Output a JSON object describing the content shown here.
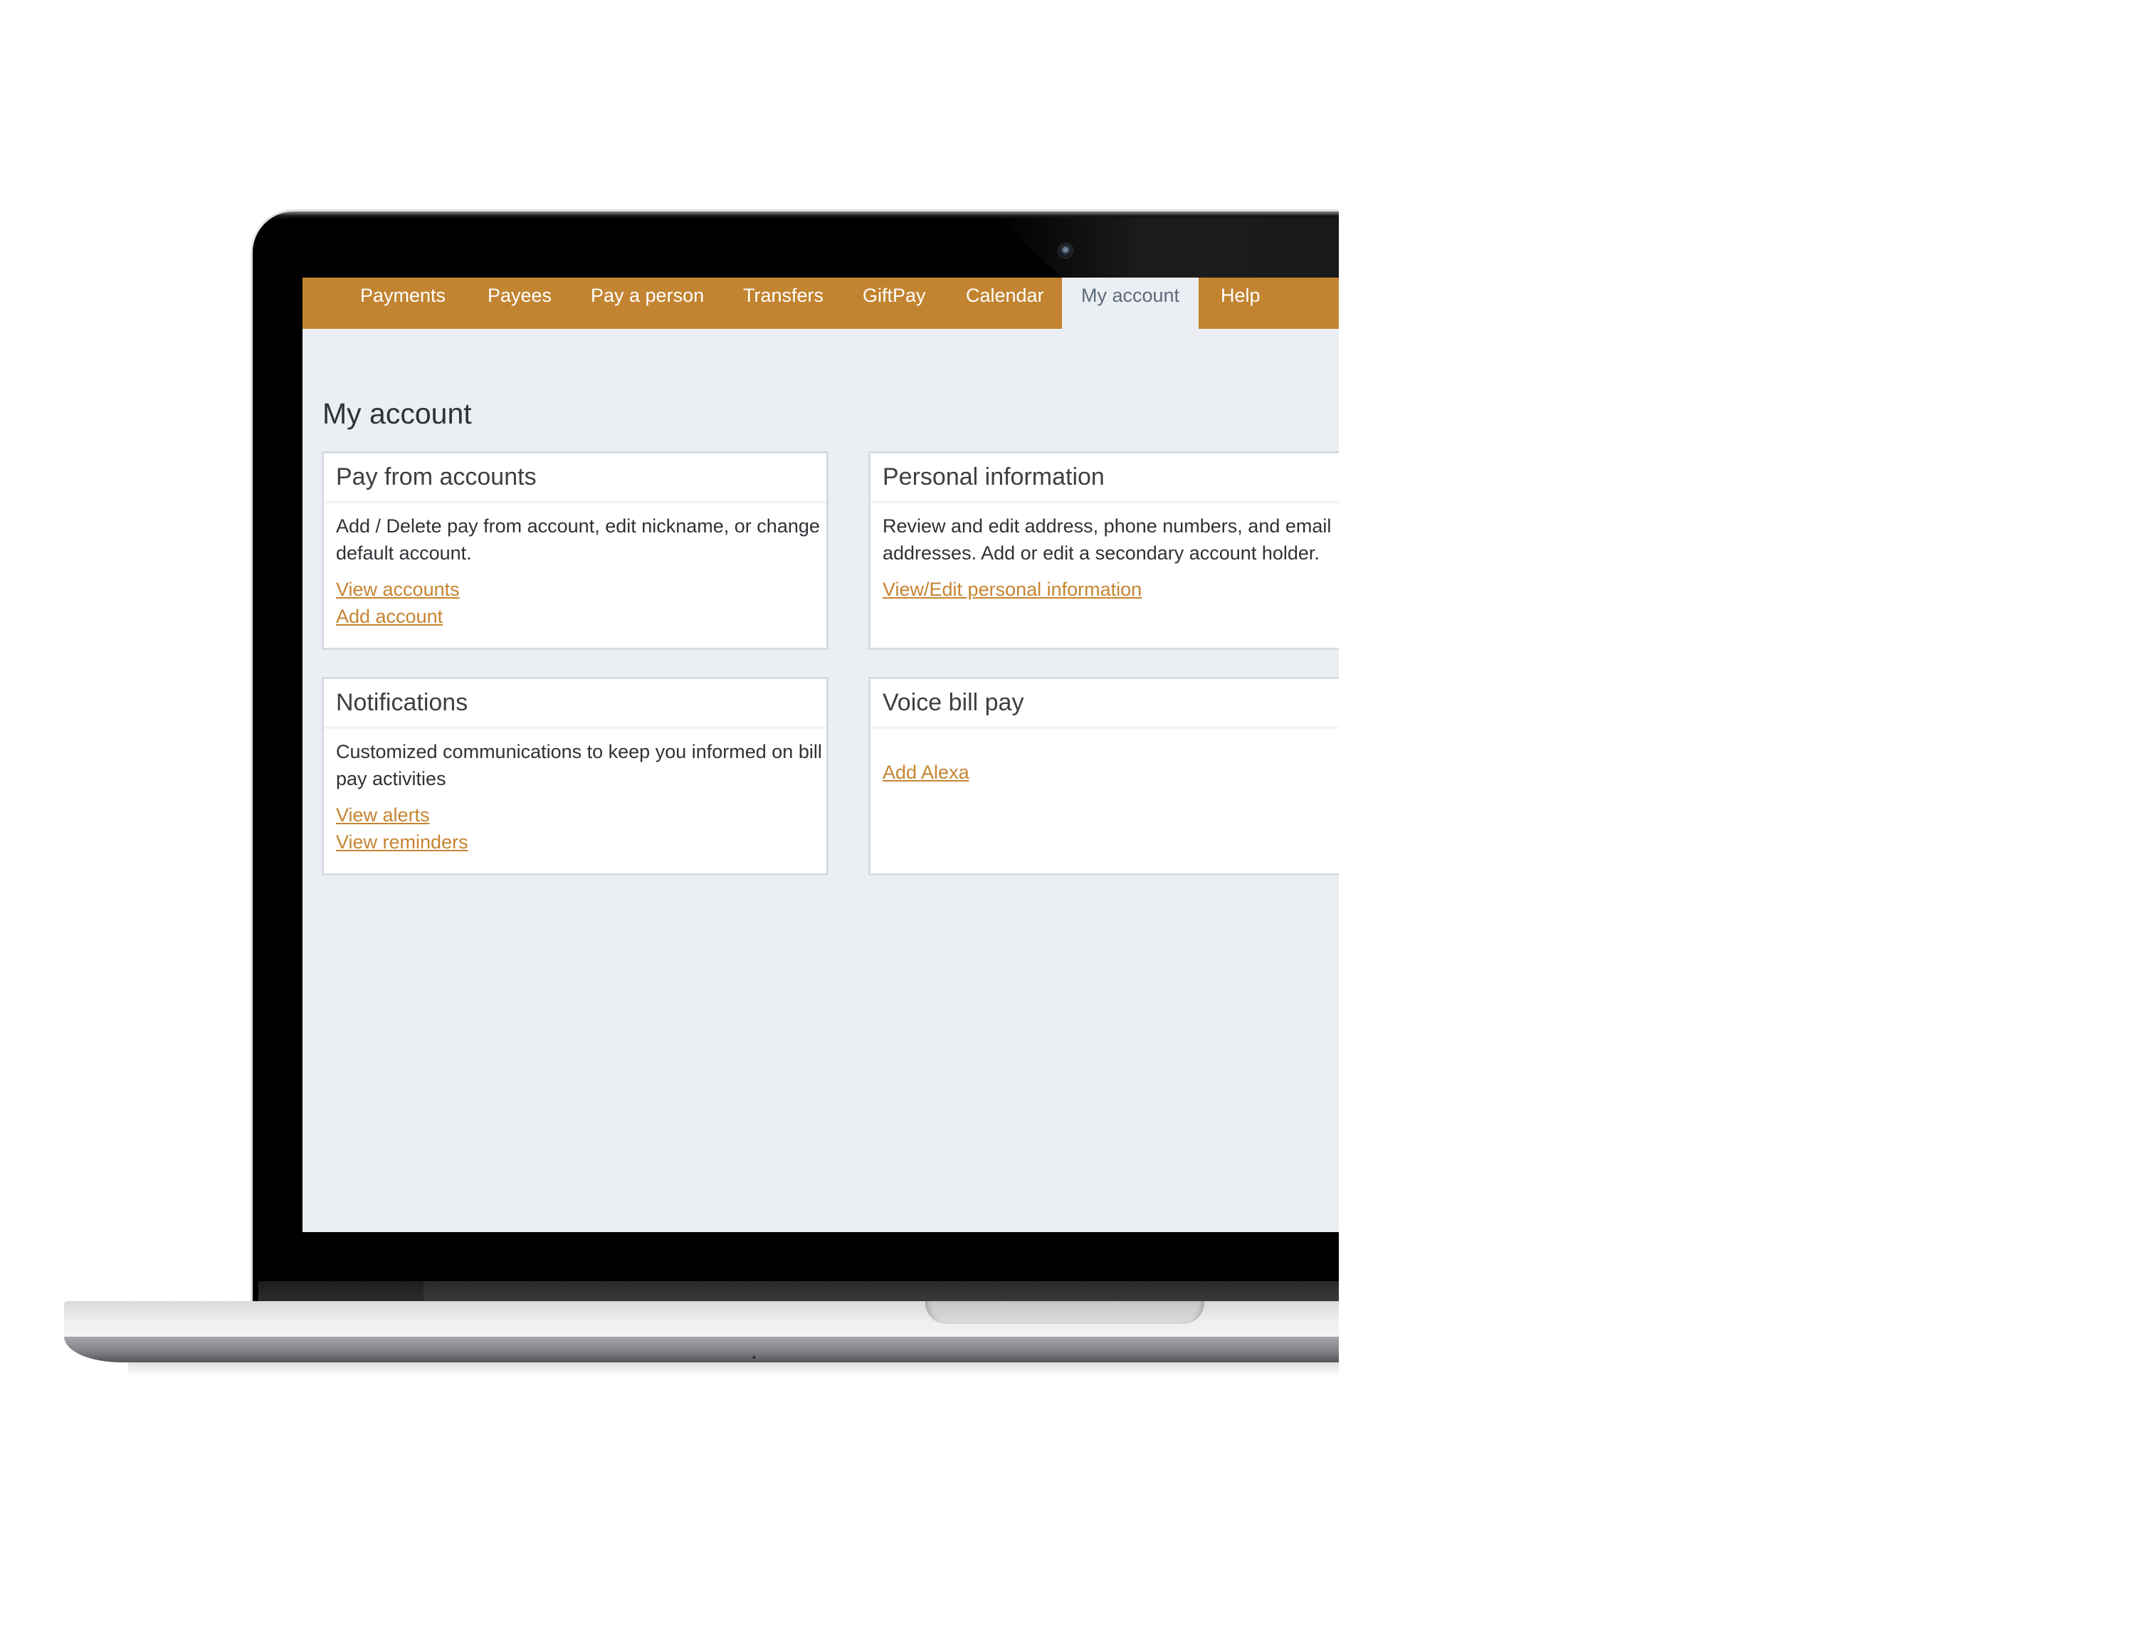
{
  "nav": {
    "items": [
      {
        "label": "Payments",
        "active": false
      },
      {
        "label": "Payees",
        "active": false
      },
      {
        "label": "Pay a person",
        "active": false
      },
      {
        "label": "Transfers",
        "active": false
      },
      {
        "label": "GiftPay",
        "active": false
      },
      {
        "label": "Calendar",
        "active": false
      },
      {
        "label": "My account",
        "active": true
      },
      {
        "label": "Help",
        "active": false
      }
    ]
  },
  "page": {
    "title": "My account"
  },
  "cards": {
    "pay_from_accounts": {
      "title": "Pay from accounts",
      "description": "Add / Delete pay from account, edit nickname, or change default account.",
      "links": [
        "View accounts",
        "Add account"
      ]
    },
    "personal_information": {
      "title": "Personal information",
      "description": "Review and edit address, phone numbers, and email addresses. Add or edit a secondary account holder.",
      "links": [
        "View/Edit personal information"
      ]
    },
    "notifications": {
      "title": "Notifications",
      "description": "Customized communications to keep you informed on bill pay activities",
      "links": [
        "View alerts",
        "View reminders"
      ]
    },
    "voice_bill_pay": {
      "title": "Voice bill pay",
      "links": [
        "Add Alexa"
      ]
    }
  },
  "theme": {
    "nav_color": "#c28431",
    "link_color": "#c68431",
    "page_background": "#ebeef3",
    "active_tab_text": "#5d6b7a"
  }
}
